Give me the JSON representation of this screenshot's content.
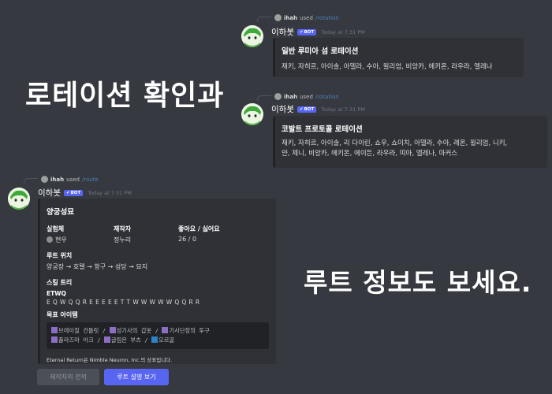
{
  "messages": [
    {
      "reply": {
        "user": "ihah",
        "verb": "used",
        "command": "/rotation"
      },
      "bot": {
        "name": "이하봇",
        "badge": "BOT",
        "time": "Today at 7:31 PM"
      },
      "embed": {
        "title": "일반 루미아 섬 로테이션",
        "desc": "재키, 자히르, 아이솔, 아델라, 수아, 윌리엄, 비앙카, 에키온, 라우라, 엘레나"
      }
    },
    {
      "reply": {
        "user": "ihah",
        "verb": "used",
        "command": "/rotation"
      },
      "bot": {
        "name": "이하봇",
        "badge": "BOT",
        "time": "Today at 7:31 PM"
      },
      "embed": {
        "title": "코발트 프로토콜 로테이션",
        "desc_lines": [
          "재키, 자히르, 아이솔, 리 다이린, 쇼우, 쇼이치, 아델라, 수아, 레온, 윌리엄, 니키,",
          "얀, 제니, 비앙카, 에키온, 에이든, 라우라, 띠아, 엘레나, 마커스"
        ]
      }
    },
    {
      "reply": {
        "user": "ihah",
        "verb": "used",
        "command": "/route"
      },
      "bot": {
        "name": "이하봇",
        "badge": "BOT",
        "time": "Today at 7:31 PM"
      },
      "embed": {
        "title": "양궁성묘",
        "fields": {
          "subject_name": "실험체",
          "subject_value": "현우",
          "author_name": "제작자",
          "author_value": "정누리",
          "likes_name": "좋아요 / 싫어요",
          "likes_value": "26 / 0",
          "route_name": "루트 위치",
          "route_value": "양궁장 → 호텔 → 항구 → 성당 → 묘지",
          "skill_name": "스킬 트리",
          "skill_order": "ETWQ",
          "skill_seq": "E Q W Q Q R E E E E E T T W W W W W Q Q R R",
          "goal_name": "목표 아이템",
          "goal_line1": "브레이질 건틀릿 / 성기사의 갑옷 / 기사단장의 투구",
          "goal_line2": "플라즈마 아크 / 글림은 부츠 / 오르골",
          "goal_items_line1": [
            "브레이질 건틀릿",
            "성기사의 갑옷",
            "기사단장의 투구"
          ],
          "goal_items_line2": [
            "플라즈마 아크",
            "글림은 부츠",
            "오르골"
          ]
        },
        "footer": "Eternal Return은 Nimble Neuron, Inc.의 상표입니다."
      },
      "buttons": {
        "author_history": "제작자의 전적",
        "route_desc": "루트 설명 보기"
      }
    }
  ],
  "overlay": {
    "rotation_caption": "로테이션 확인과",
    "route_caption": "루트 정보도 보세요."
  },
  "colors": {
    "background": "#36393f",
    "embed": "#2f3136",
    "blurple": "#5865f2",
    "item_purple": "#8c6fc4",
    "item_blue": "#2c82c9"
  }
}
